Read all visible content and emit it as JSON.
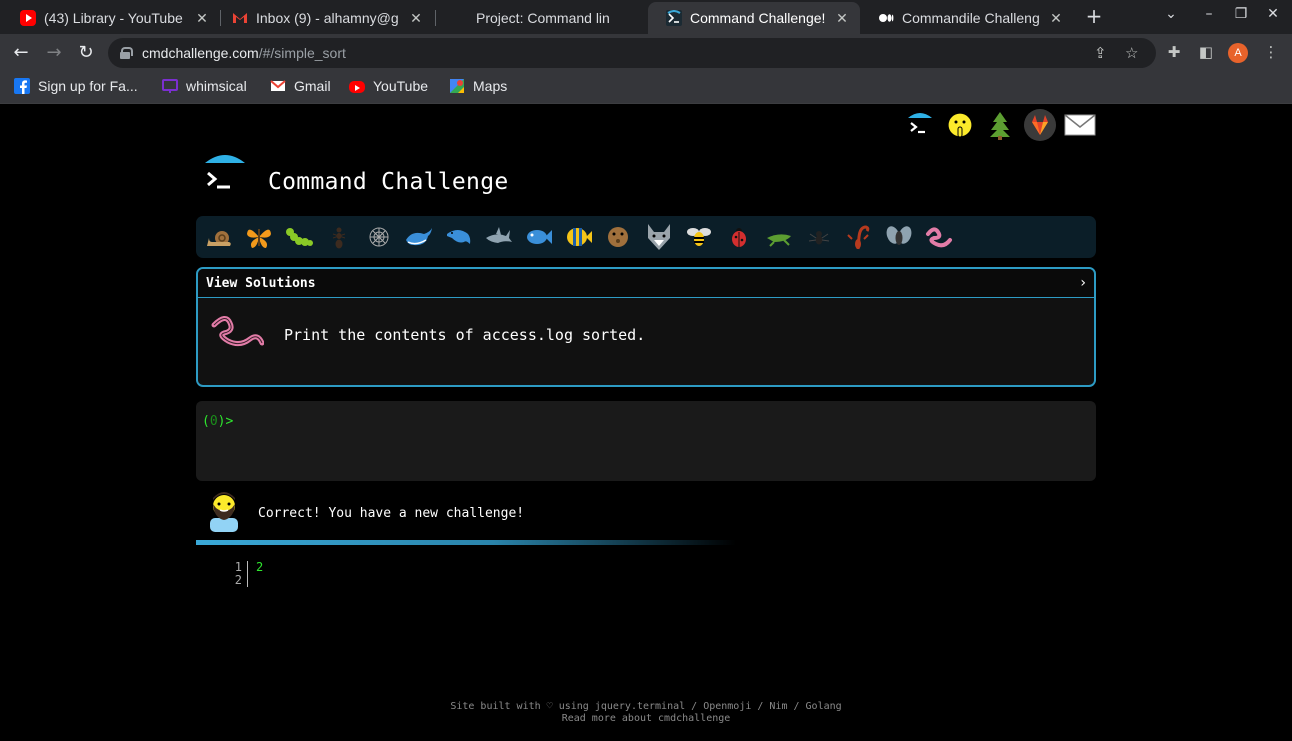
{
  "browser": {
    "tabs": [
      {
        "title": "(43) Library - YouTube",
        "favicon": "youtube-icon",
        "active": false
      },
      {
        "title": "Inbox (9) - alhamny@g",
        "favicon": "gmail-icon",
        "active": false
      },
      {
        "title": "Project: Command lin",
        "favicon": "project-icon",
        "active": false
      },
      {
        "title": "Command Challenge!",
        "favicon": "terminal-icon",
        "active": true
      },
      {
        "title": "Commandile Challeng",
        "favicon": "medium-icon",
        "active": false
      }
    ],
    "address": {
      "host": "cmdchallenge.com",
      "path": "/#/simple_sort"
    },
    "profile_initial": "A",
    "bookmarks": [
      {
        "label": "Sign up for Fa...",
        "icon": "facebook-icon"
      },
      {
        "label": "whimsical",
        "icon": "whimsical-icon"
      },
      {
        "label": "Gmail",
        "icon": "gmail-icon"
      },
      {
        "label": "YouTube",
        "icon": "youtube-icon"
      },
      {
        "label": "Maps",
        "icon": "maps-icon"
      }
    ]
  },
  "site": {
    "title": "Command Challenge",
    "top_icons": [
      "terminal-logo-icon",
      "shushing-face-icon",
      "tree-icon",
      "gitlab-icon",
      "envelope-icon"
    ],
    "critters": [
      "snail-icon",
      "butterfly-icon",
      "caterpillar-icon",
      "ant-icon",
      "spider-web-icon",
      "whale-icon",
      "dolphin-icon",
      "shark-icon",
      "fish-icon",
      "tropical-fish-icon",
      "pufferfish-icon",
      "wolf-icon",
      "bee-icon",
      "ladybug-icon",
      "cricket-icon",
      "spider-icon",
      "scorpion-icon",
      "fly-icon",
      "worm-icon"
    ]
  },
  "challenge": {
    "solutions_label": "View Solutions",
    "chevron": "›",
    "description": "Print the contents of access.log sorted.",
    "icon": "worm-icon"
  },
  "terminal": {
    "prompt_open": "(",
    "prompt_count": "0",
    "prompt_close": ")>"
  },
  "feedback": {
    "message": "Correct! You have a new challenge!",
    "avatar": "bearded-man-icon",
    "progress": 0.6
  },
  "output": {
    "line_numbers": [
      "1",
      "2"
    ],
    "lines": [
      "2",
      ""
    ]
  },
  "footer": {
    "line1": "Site built with ♡ using jquery.terminal / Openmoji / Nim / Golang",
    "line2": "Read more about cmdchallenge"
  },
  "colors": {
    "accent": "#2d9bc4",
    "prompt_green": "#2ee62e",
    "critter_bar": "#0b1e28"
  }
}
